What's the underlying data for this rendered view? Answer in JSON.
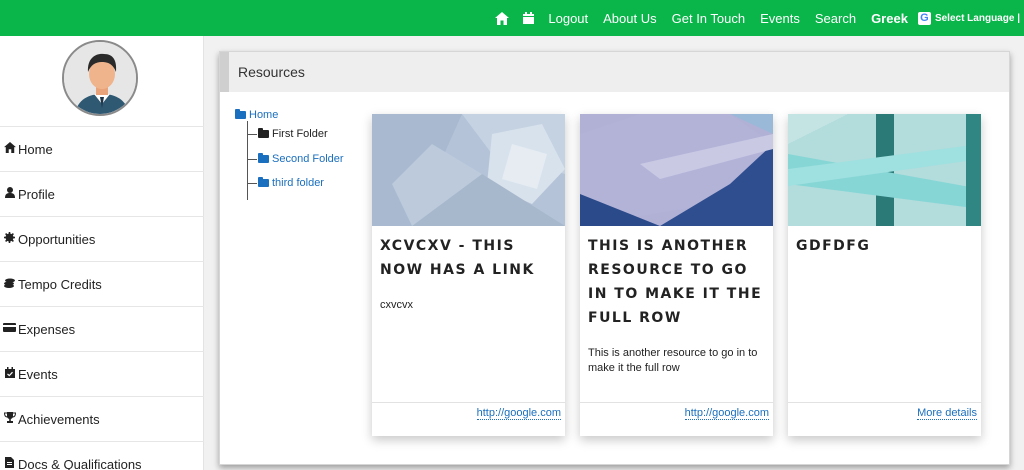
{
  "colors": {
    "topbar": "#0ab54a",
    "link": "#1a6fbe"
  },
  "topnav": {
    "home_icon": "home-icon",
    "calendar_icon": "calendar-icon",
    "links": [
      "Logout",
      "About Us",
      "Get In Touch",
      "Events",
      "Search"
    ],
    "language": "Greek",
    "google_letter": "G",
    "select_language": "Select Language",
    "separator": "|"
  },
  "sidebar": {
    "items": [
      {
        "icon": "home-icon",
        "glyph": "⌂",
        "label": "Home"
      },
      {
        "icon": "user-icon",
        "glyph": "●",
        "label": "Profile"
      },
      {
        "icon": "gear-icon",
        "glyph": "✹",
        "label": "Opportunities"
      },
      {
        "icon": "coins-icon",
        "glyph": "≣",
        "label": "Tempo Credits"
      },
      {
        "icon": "credit-card-icon",
        "glyph": "▬",
        "label": "Expenses"
      },
      {
        "icon": "calendar-check-icon",
        "glyph": "▣",
        "label": "Events"
      },
      {
        "icon": "trophy-icon",
        "glyph": "♛",
        "label": "Achievements"
      },
      {
        "icon": "file-icon",
        "glyph": "▤",
        "label": "Docs & Qualifications"
      }
    ]
  },
  "panel": {
    "title": "Resources",
    "tree": {
      "root": "Home",
      "children": [
        "First Folder",
        "Second Folder",
        "third folder"
      ]
    },
    "cards": [
      {
        "title": "XCVCXV - THIS NOW HAS A LINK",
        "description": "cxvcvx",
        "link": "http://google.com"
      },
      {
        "title": "THIS IS ANOTHER RESOURCE TO GO IN TO MAKE IT THE FULL ROW",
        "description": "This is another resource to go in to make it the full row",
        "link": "http://google.com"
      },
      {
        "title": "GDFDFG",
        "description": "",
        "link": "More details"
      }
    ]
  }
}
